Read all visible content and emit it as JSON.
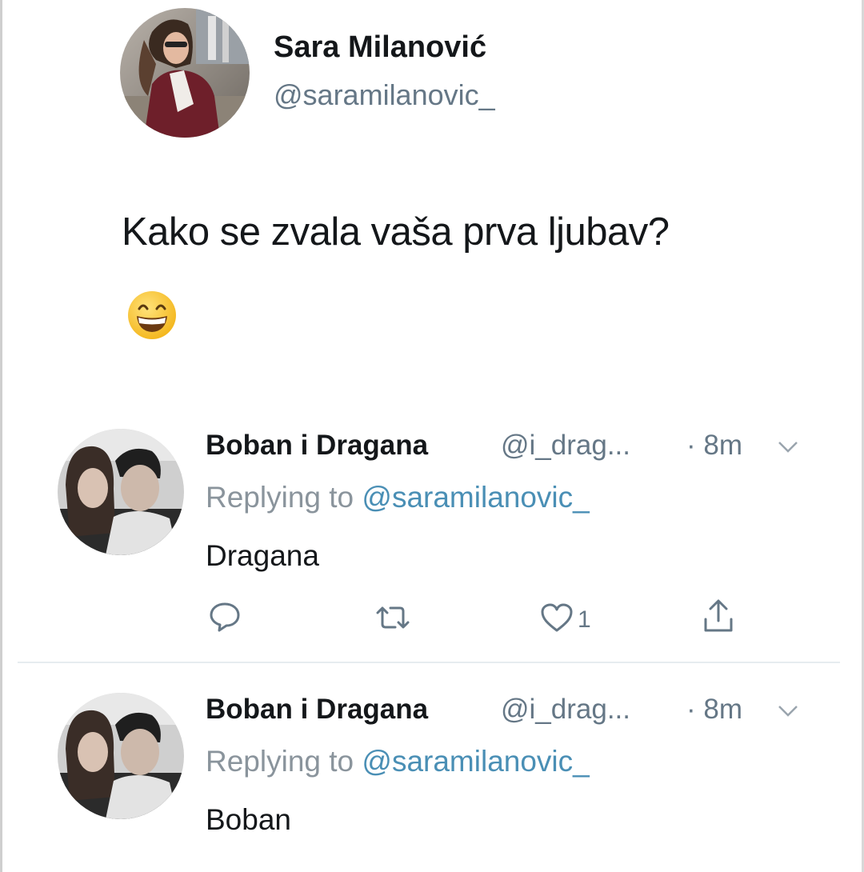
{
  "main_tweet": {
    "author_name": "Sara Milanović",
    "author_handle": "@saramilanovic_",
    "text": "Kako se zvala vaša prva ljubav?",
    "emoji_icon": "grinning-face-with-smiling-eyes-icon"
  },
  "replies": [
    {
      "author_name": "Boban i Dragana",
      "author_handle": "@i_drag...",
      "time": "· 8m",
      "replying_prefix": "Replying to ",
      "replying_mention": "@saramilanovic_",
      "text": "Dragana",
      "actions": {
        "reply_icon": "comment-icon",
        "retweet_icon": "retweet-icon",
        "like_icon": "heart-icon",
        "like_count": "1",
        "share_icon": "share-icon"
      }
    },
    {
      "author_name": "Boban i Dragana",
      "author_handle": "@i_drag...",
      "time": "· 8m",
      "replying_prefix": "Replying to ",
      "replying_mention": "@saramilanovic_",
      "text": "Boban"
    }
  ],
  "colors": {
    "text_primary": "#14171a",
    "text_secondary": "#657786",
    "mention": "#4a8fb5",
    "divider": "#e6ecf0"
  }
}
